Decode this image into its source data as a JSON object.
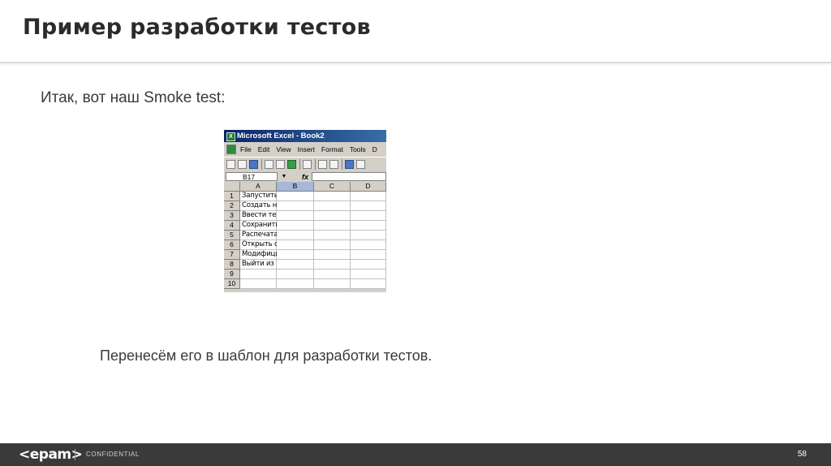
{
  "slide": {
    "title": "Пример разработки тестов",
    "intro": "Итак, вот наш Smoke test:",
    "caption": "Перенесём его в шаблон для разработки тестов."
  },
  "excel": {
    "window_title": "Microsoft Excel - Book2",
    "menu": [
      "File",
      "Edit",
      "View",
      "Insert",
      "Format",
      "Tools",
      "D"
    ],
    "name_box": "B17",
    "fx_label": "fx",
    "columns": [
      "A",
      "B",
      "C",
      "D"
    ],
    "active_column": "B",
    "rows": [
      {
        "num": "1",
        "a": "Запустить приложение"
      },
      {
        "num": "2",
        "a": "Создать новый файл"
      },
      {
        "num": "3",
        "a": "Ввести текст"
      },
      {
        "num": "4",
        "a": "Сохранить файл"
      },
      {
        "num": "5",
        "a": "Распечатать файл"
      },
      {
        "num": "6",
        "a": "Открыть существующий файл"
      },
      {
        "num": "7",
        "a": "Модифицировать файл"
      },
      {
        "num": "8",
        "a": "Выйти из приложения"
      },
      {
        "num": "9",
        "a": ""
      },
      {
        "num": "10",
        "a": ""
      }
    ]
  },
  "footer": {
    "logo": "<epam>",
    "label": "CONFIDENTIAL",
    "page_number": "58"
  }
}
